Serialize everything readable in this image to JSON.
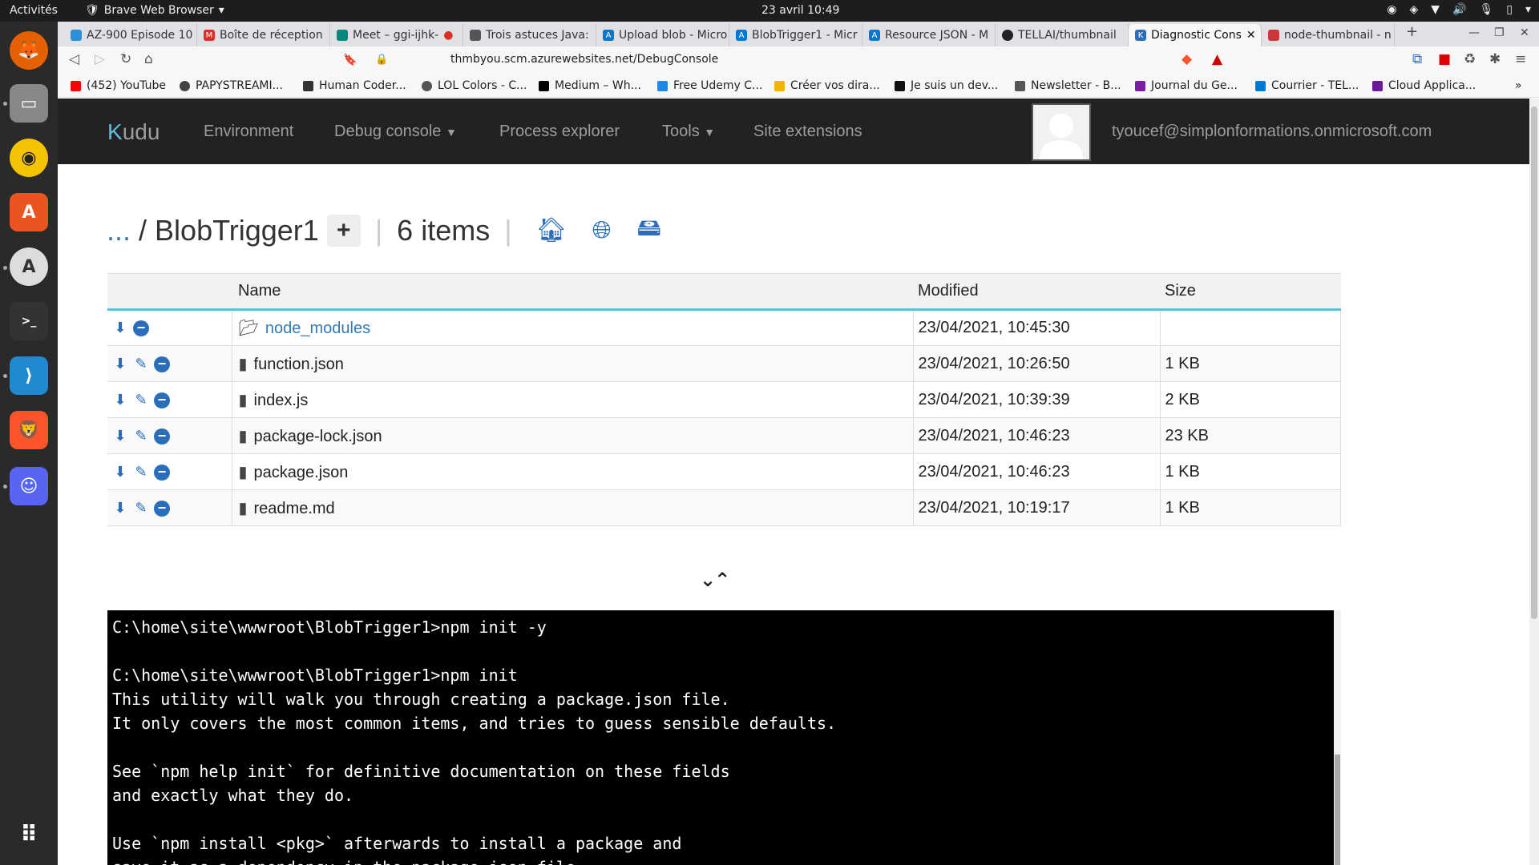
{
  "os": {
    "activities": "Activités",
    "app_name": "Brave Web Browser",
    "clock": "23 avril  10:49"
  },
  "tabs": [
    {
      "label": "AZ-900 Episode 10",
      "color": "#2a90d9"
    },
    {
      "label": "Boîte de réception",
      "color": "#d93025"
    },
    {
      "label": "Meet – ggi-ijhk-",
      "color": "#00897b"
    },
    {
      "label": "Trois astuces Java:",
      "color": "#555555"
    },
    {
      "label": "Upload blob - Micro",
      "color": "#0078d4"
    },
    {
      "label": "BlobTrigger1 - Micr",
      "color": "#0078d4"
    },
    {
      "label": "Resource JSON - M",
      "color": "#0078d4"
    },
    {
      "label": "TELLAI/thumbnail",
      "color": "#222222"
    },
    {
      "label": "Diagnostic Cons",
      "color": "#2a6ebb"
    },
    {
      "label": "node-thumbnail - n",
      "color": "#cb3837"
    }
  ],
  "address": {
    "url": "thmbyou.scm.azurewebsites.net/DebugConsole"
  },
  "bookmarks": [
    {
      "label": "(452) YouTube",
      "color": "#ff0000"
    },
    {
      "label": "PAPYSTREAMI...",
      "color": "#444444"
    },
    {
      "label": "Human Coder...",
      "color": "#333333"
    },
    {
      "label": "LOL Colors - C...",
      "color": "#555555"
    },
    {
      "label": "Medium – Wh...",
      "color": "#000000"
    },
    {
      "label": "Free Udemy C...",
      "color": "#1e88e5"
    },
    {
      "label": "Créer vos dira...",
      "color": "#f2b400"
    },
    {
      "label": "Je suis un dev...",
      "color": "#111111"
    },
    {
      "label": "Newsletter - B...",
      "color": "#555555"
    },
    {
      "label": "Journal du Ge...",
      "color": "#7b1fa2"
    },
    {
      "label": "Courrier - TEL...",
      "color": "#0078d4"
    },
    {
      "label": "Cloud Applica...",
      "color": "#6a1b9a"
    }
  ],
  "kudu": {
    "brand": "Kudu",
    "nav": {
      "environment": "Environment",
      "debug_console": "Debug console",
      "process_explorer": "Process explorer",
      "tools": "Tools",
      "site_extensions": "Site extensions"
    },
    "user_email": "tyoucef@simplonformations.onmicrosoft.com"
  },
  "breadcrumb": {
    "dots": "...",
    "slash": "/",
    "folder": "BlobTrigger1",
    "add": "+",
    "count": "6 items"
  },
  "table": {
    "headers": {
      "name": "Name",
      "modified": "Modified",
      "size": "Size"
    },
    "rows": [
      {
        "name": "node_modules",
        "modified": "23/04/2021, 10:45:30",
        "size": ""
      },
      {
        "name": "function.json",
        "modified": "23/04/2021, 10:26:50",
        "size": "1 KB"
      },
      {
        "name": "index.js",
        "modified": "23/04/2021, 10:39:39",
        "size": "2 KB"
      },
      {
        "name": "package-lock.json",
        "modified": "23/04/2021, 10:46:23",
        "size": "23 KB"
      },
      {
        "name": "package.json",
        "modified": "23/04/2021, 10:46:23",
        "size": "1 KB"
      },
      {
        "name": "readme.md",
        "modified": "23/04/2021, 10:19:17",
        "size": "1 KB"
      }
    ]
  },
  "console": {
    "lines": [
      "C:\\home\\site\\wwwroot\\BlobTrigger1>npm init -y",
      "",
      "C:\\home\\site\\wwwroot\\BlobTrigger1>npm init",
      "This utility will walk you through creating a package.json file.",
      "It only covers the most common items, and tries to guess sensible defaults.",
      "",
      "See `npm help init` for definitive documentation on these fields",
      "and exactly what they do.",
      "",
      "Use `npm install <pkg>` afterwards to install a package and",
      "save it as a dependency in the package.json file."
    ]
  }
}
